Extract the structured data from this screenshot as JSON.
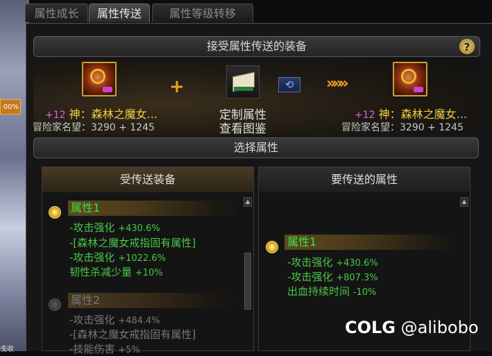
{
  "tabs": [
    {
      "label": "属性成长",
      "active": false
    },
    {
      "label": "属性传送",
      "active": true
    },
    {
      "label": "属性等级转移",
      "active": false
    }
  ],
  "background": {
    "left_badge": "00%",
    "left_bottom": "戋收"
  },
  "header": {
    "title": "接受属性传送的装备",
    "help": "?"
  },
  "source_item": {
    "enhance": "+12",
    "name": "神：森林之魔女...",
    "fame": "冒险家名望：3290 + 1245"
  },
  "target_item": {
    "enhance": "+12",
    "name": "神：森林之魔女...",
    "fame": "冒险家名望：3290 + 1245"
  },
  "center": {
    "plus": "+",
    "custom_line1": "定制属性",
    "custom_line2": "查看图鉴",
    "arrows": "»»»"
  },
  "select_bar": {
    "title": "选择属性"
  },
  "left_panel": {
    "title": "受传送装备",
    "attr1": {
      "label": "属性1",
      "lines": [
        {
          "text": "-攻击强化 ",
          "num": "+430.6%"
        },
        {
          "text": "-[森林之魔女戒指固有属性]",
          "num": ""
        },
        {
          "text": "-攻击强化 ",
          "num": "+1022.6%"
        },
        {
          "text": " 韧性杀减少量 ",
          "num": "+10%"
        }
      ]
    },
    "attr2": {
      "label": "属性2",
      "lines": [
        {
          "text": "-攻击强化 ",
          "num": "+484.4%"
        },
        {
          "text": "-[森林之魔女戒指固有属性]",
          "num": ""
        },
        {
          "text": "-技能伤害 ",
          "num": "+5%"
        }
      ]
    }
  },
  "right_panel": {
    "title": "要传送的属性",
    "attr1": {
      "label": "属性1",
      "lines": [
        {
          "text": "-攻击强化 ",
          "num": "+430.6%"
        },
        {
          "text": "-攻击强化 ",
          "num": "+807.3%"
        },
        {
          "text": " 出血持续时间 ",
          "num": "-10%"
        }
      ]
    }
  },
  "watermark": {
    "logo": "COLG",
    "handle": "@alibobo"
  }
}
